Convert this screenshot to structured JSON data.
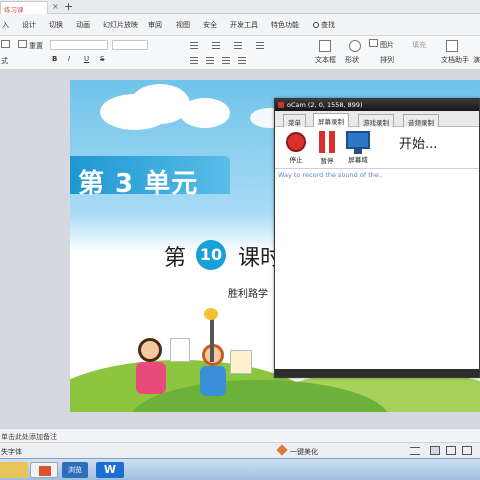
{
  "app": {
    "doc_tab": "练习课",
    "tab_close": "×",
    "tab_add": "+"
  },
  "menu": {
    "items": [
      "入",
      "设计",
      "切换",
      "动画",
      "幻灯片放映",
      "审阅",
      "视图",
      "安全",
      "开发工具",
      "特色功能"
    ],
    "search_label": "查找"
  },
  "ribbon": {
    "reset": "重置",
    "format_label": "式",
    "bold": "B",
    "italic": "I",
    "underline": "U",
    "strike": "S",
    "textbox": "文本框",
    "shape": "形状",
    "arrange": "排列",
    "picture": "图片",
    "fill": "填充",
    "doc_helper": "文档助手",
    "extra": "演"
  },
  "slide": {
    "unit_title": "第 3 单元",
    "lesson_prefix": "第",
    "lesson_number": "10",
    "lesson_suffix": "课时",
    "school": "胜利路学"
  },
  "ocam": {
    "title": "oCam (2, 0, 1558, 899)",
    "tabs": [
      "菜单",
      "屏幕录制",
      "游戏录制",
      "音频录制"
    ],
    "active_tab": "屏幕录制",
    "stop_label": "停止",
    "pause_label": "暂停",
    "area_label": "屏幕域",
    "start_text": "开始...",
    "hint": "Way to record the sound of the..",
    "colors": {
      "stop": "#d9302b",
      "pause": "#d9302b",
      "monitor": "#2a78c8"
    }
  },
  "notes": {
    "placeholder": "单击此处添加备注"
  },
  "status": {
    "font_missing": "失字体",
    "beautify": "一键美化"
  },
  "taskbar": {
    "items": [
      "folder-icon",
      "slides-icon",
      "browser-icon",
      "wps-icon"
    ],
    "browser_label": "浏览"
  }
}
